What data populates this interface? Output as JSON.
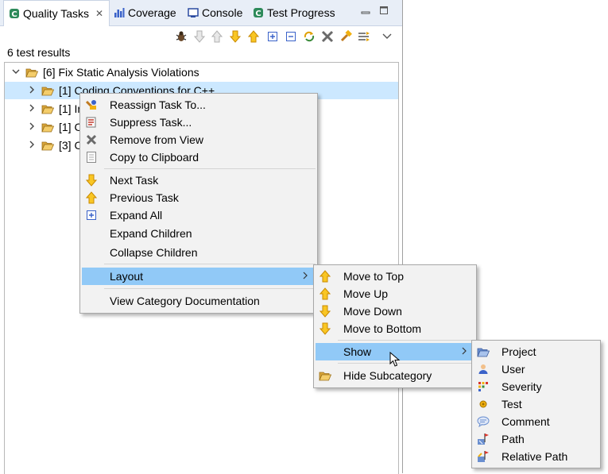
{
  "tabs": [
    {
      "label": "Quality Tasks",
      "active": true,
      "closable": true
    },
    {
      "label": "Coverage"
    },
    {
      "label": "Console"
    },
    {
      "label": "Test Progress"
    }
  ],
  "toolbar_icons": [
    "bug-icon",
    "arrow-down-disabled-icon",
    "arrow-up-disabled-icon",
    "arrow-down-icon",
    "arrow-up-icon",
    "expand-all-icon",
    "collapse-all-icon",
    "sync-icon",
    "remove-all-icon",
    "hammer-icon",
    "layout-icon",
    "view-menu-icon"
  ],
  "results_count": "6 test results",
  "tree": {
    "root": "[6] Fix Static Analysis Violations",
    "children": [
      "[1] Coding Conventions for C++",
      "[1] In",
      "[1] C",
      "[3] C"
    ]
  },
  "context_menu": {
    "items": [
      {
        "label": "Reassign Task To...",
        "icon": "reassign-icon"
      },
      {
        "label": "Suppress Task...",
        "icon": "suppress-icon"
      },
      {
        "label": "Remove from View",
        "icon": "remove-icon"
      },
      {
        "label": "Copy to Clipboard",
        "icon": "clipboard-icon"
      },
      {
        "label": "Next Task",
        "icon": "arrow-down-icon"
      },
      {
        "label": "Previous Task",
        "icon": "arrow-up-icon"
      },
      {
        "label": "Expand All",
        "icon": "expand-all-icon"
      },
      {
        "label": "Expand Children"
      },
      {
        "label": "Collapse Children"
      },
      {
        "label": "Layout",
        "submenu": true,
        "highlighted": true
      },
      {
        "label": "View Category Documentation"
      }
    ]
  },
  "layout_menu": {
    "items": [
      {
        "label": "Move to Top",
        "icon": "arrow-up-icon"
      },
      {
        "label": "Move Up",
        "icon": "arrow-up-icon"
      },
      {
        "label": "Move Down",
        "icon": "arrow-down-icon"
      },
      {
        "label": "Move to Bottom",
        "icon": "arrow-down-icon"
      },
      {
        "label": "Show",
        "submenu": true,
        "highlighted": true
      },
      {
        "label": "Hide Subcategory",
        "icon": "folder-icon"
      }
    ]
  },
  "show_menu": {
    "items": [
      {
        "label": "Project",
        "icon": "folder-icon"
      },
      {
        "label": "User",
        "icon": "user-icon"
      },
      {
        "label": "Severity",
        "icon": "severity-icon"
      },
      {
        "label": "Test",
        "icon": "test-icon"
      },
      {
        "label": "Comment",
        "icon": "comment-icon"
      },
      {
        "label": "Path",
        "icon": "path-icon"
      },
      {
        "label": "Relative Path",
        "icon": "relative-path-icon"
      }
    ]
  },
  "colors": {
    "tab_bar_bg": "#e8eef7",
    "selection_bg": "#cce8ff",
    "menu_bg": "#f2f2f2",
    "menu_highlight": "#91c9f7",
    "arrow_yellow": "#f2b10f"
  }
}
